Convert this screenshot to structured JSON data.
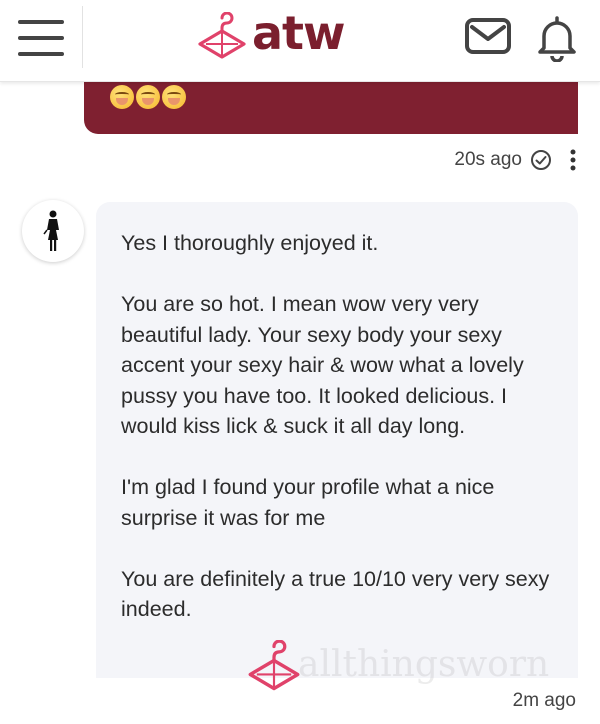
{
  "header": {
    "logo_text": "atw",
    "brand_color": "#7b1f2e",
    "icons": {
      "menu": "hamburger-menu-icon",
      "mail": "envelope-icon",
      "bell": "bell-icon",
      "logo": "hanger-icon"
    }
  },
  "sent_message": {
    "emojis": [
      "hand-over-mouth-emoji",
      "hand-over-mouth-emoji",
      "hand-over-mouth-emoji"
    ],
    "bubble_color": "#7f2030",
    "time": "20s ago",
    "status_icon": "check-circle-icon"
  },
  "received_message": {
    "avatar_icon": "woman-silhouette-icon",
    "paragraphs": [
      "Yes I thoroughly enjoyed it.",
      "You are so hot. I mean wow very very beautiful lady. Your sexy body your sexy accent your sexy hair & wow what a lovely pussy you have too. It looked delicious. I would kiss lick & suck it all day long.",
      "I'm glad I found your profile what a nice surprise it was for me",
      "You are definitely a true 10/10 very very sexy indeed."
    ],
    "time": "2m ago"
  },
  "watermark": {
    "text": "allthingsworn"
  }
}
